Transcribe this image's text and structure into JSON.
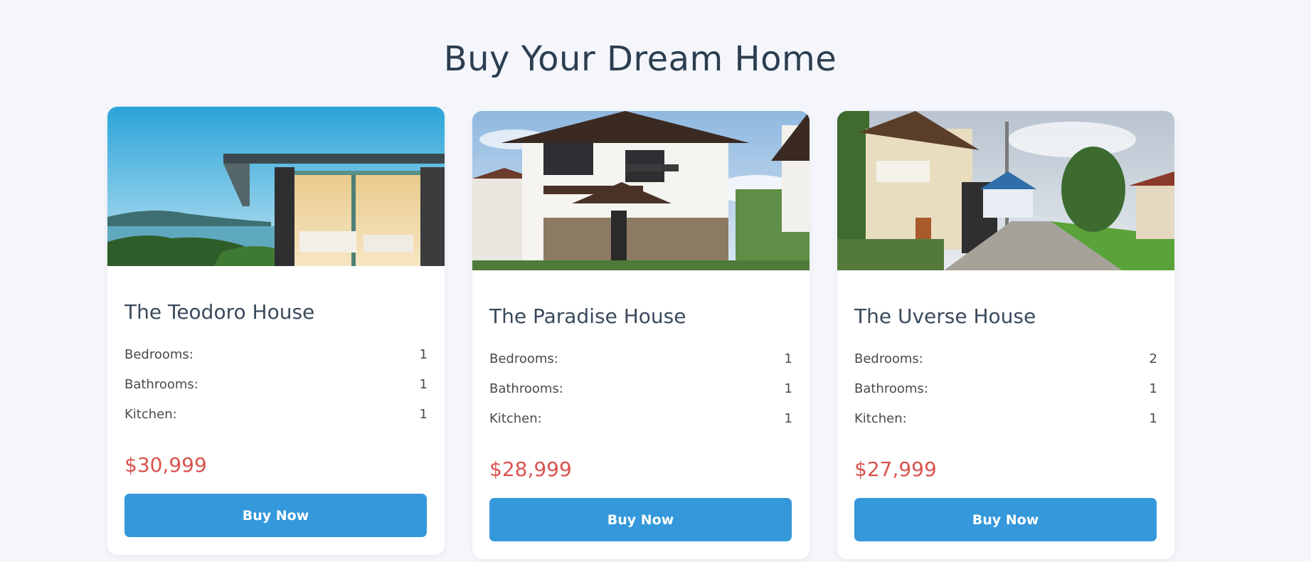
{
  "page": {
    "title": "Buy Your Dream Home"
  },
  "labels": {
    "bedrooms": "Bedrooms:",
    "bathrooms": "Bathrooms:",
    "kitchen": "Kitchen:"
  },
  "cards": [
    {
      "name": "The Teodoro House",
      "bedrooms": "1",
      "bathrooms": "1",
      "kitchen": "1",
      "price": "$30,999",
      "button_label": "Buy Now"
    },
    {
      "name": "The Paradise House",
      "bedrooms": "1",
      "bathrooms": "1",
      "kitchen": "1",
      "price": "$28,999",
      "button_label": "Buy Now"
    },
    {
      "name": "The Uverse House",
      "bedrooms": "2",
      "bathrooms": "1",
      "kitchen": "1",
      "price": "$27,999",
      "button_label": "Buy Now"
    }
  ],
  "colors": {
    "background": "#f4f6fb",
    "price": "#d9534f",
    "button": "#3498db",
    "title": "#2c3e50"
  }
}
